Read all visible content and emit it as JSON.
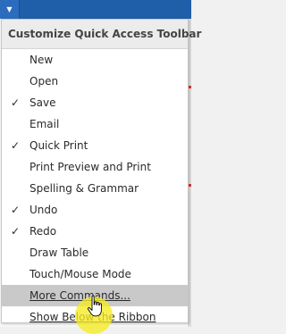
{
  "qat": {
    "caret_icon": "dropdown-caret-icon"
  },
  "menu": {
    "title": "Customize Quick Access Toolbar",
    "items": [
      {
        "label": "New",
        "checked": false
      },
      {
        "label": "Open",
        "checked": false
      },
      {
        "label": "Save",
        "checked": true
      },
      {
        "label": "Email",
        "checked": false
      },
      {
        "label": "Quick Print",
        "checked": true
      },
      {
        "label": "Print Preview and Print",
        "checked": false
      },
      {
        "label": "Spelling & Grammar",
        "checked": false
      },
      {
        "label": "Undo",
        "checked": true
      },
      {
        "label": "Redo",
        "checked": true
      },
      {
        "label": "Draw Table",
        "checked": false
      },
      {
        "label": "Touch/Mouse Mode",
        "checked": false
      },
      {
        "label": "More Commands...",
        "checked": false,
        "highlighted": true
      },
      {
        "label": "Show Below the Ribbon",
        "checked": false
      }
    ]
  },
  "colors": {
    "ribbon": "#1f5ea8",
    "highlight": "#c9c9c9",
    "cursor_halo": "#f6ec23"
  },
  "check_glyph": "✓"
}
